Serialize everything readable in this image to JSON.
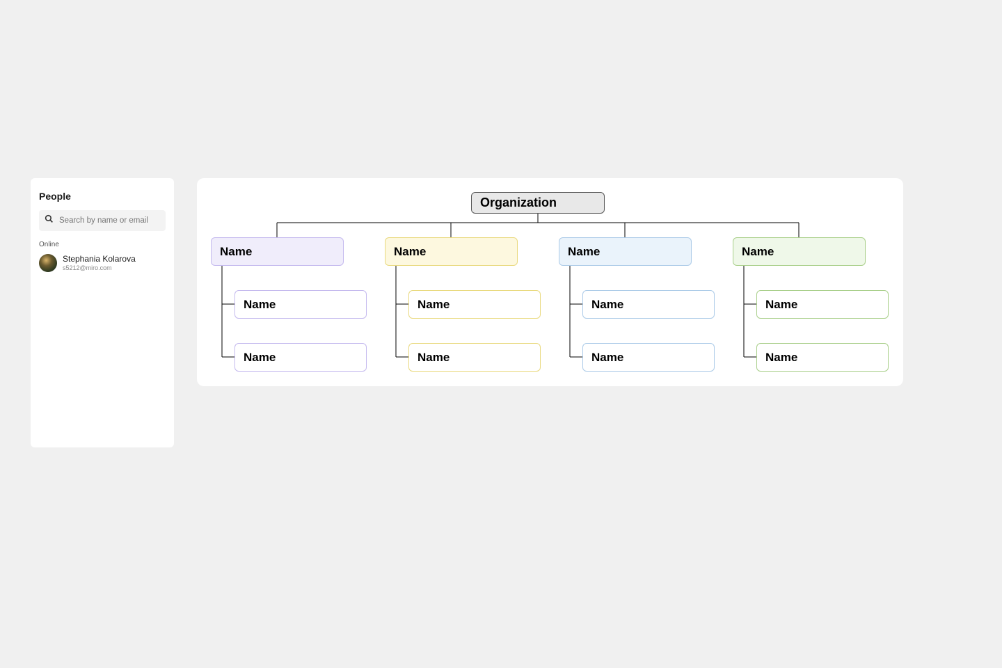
{
  "people_panel": {
    "title": "People",
    "search_placeholder": "Search by name or email",
    "status_header": "Online",
    "users": [
      {
        "name": "Stephania Kolarova",
        "email": "s5212@miro.com"
      }
    ]
  },
  "org_chart": {
    "root": {
      "label": "Organization"
    },
    "columns": [
      {
        "color": "purple",
        "dept": "Name",
        "leaves": [
          "Name",
          "Name"
        ]
      },
      {
        "color": "yellow",
        "dept": "Name",
        "leaves": [
          "Name",
          "Name"
        ]
      },
      {
        "color": "blue",
        "dept": "Name",
        "leaves": [
          "Name",
          "Name"
        ]
      },
      {
        "color": "green",
        "dept": "Name",
        "leaves": [
          "Name",
          "Name"
        ]
      }
    ]
  },
  "chart_data": {
    "type": "org-chart",
    "root": "Organization",
    "children": [
      {
        "label": "Name",
        "color": "purple",
        "children": [
          "Name",
          "Name"
        ]
      },
      {
        "label": "Name",
        "color": "yellow",
        "children": [
          "Name",
          "Name"
        ]
      },
      {
        "label": "Name",
        "color": "blue",
        "children": [
          "Name",
          "Name"
        ]
      },
      {
        "label": "Name",
        "color": "green",
        "children": [
          "Name",
          "Name"
        ]
      }
    ]
  }
}
